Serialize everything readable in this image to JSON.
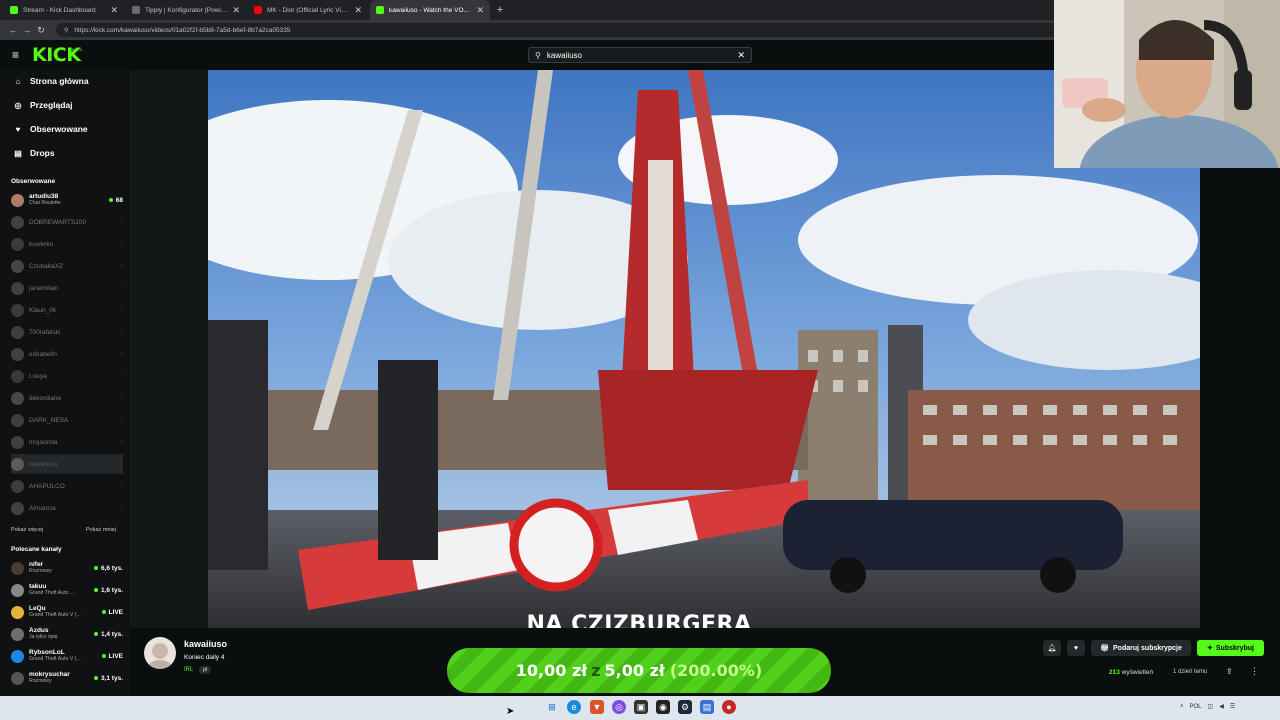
{
  "browser": {
    "tabs": [
      {
        "label": "Stream - Kick Dashboard",
        "color": "#53fc18",
        "active": false
      },
      {
        "label": "Tipply | Konfigurator (Powiadomi",
        "color": "#6b6b6b",
        "active": false
      },
      {
        "label": "MK - Dior (Official Lyric Video) ft.",
        "color": "#ff0000",
        "active": false
      },
      {
        "label": "kawaiiuso - Watch the VOD o",
        "color": "#53fc18",
        "active": true
      }
    ],
    "url": "https://kick.com/kawaiiuso/videos/01a02f2f-b5b8-7a5d-b6ef-8b7a2ca05335"
  },
  "header": {
    "logo": "KICK",
    "logo_badge": "BETA",
    "search_value": "kawaiiuso"
  },
  "sidebar": {
    "nav": [
      {
        "label": "Strona główna",
        "icon": "home-icon"
      },
      {
        "label": "Przeglądaj",
        "icon": "compass-icon"
      },
      {
        "label": "Obserwowane",
        "icon": "heart-icon"
      },
      {
        "label": "Drops",
        "icon": "drops-icon"
      }
    ],
    "followed_title": "Obserwowane",
    "followed": [
      {
        "name": "artudiu38",
        "sub": "Chat Roulette",
        "count": "68",
        "live": true
      },
      {
        "name": "DOBREWARTS100",
        "live": false
      },
      {
        "name": "kuwerku",
        "live": false
      },
      {
        "name": "CzubakaXZ",
        "live": false
      },
      {
        "name": "janemilian",
        "live": false
      },
      {
        "name": "Klaun_0k",
        "live": false
      },
      {
        "name": "700rafalski",
        "live": false
      },
      {
        "name": "erikabelin",
        "live": false
      },
      {
        "name": "Loeya",
        "live": false
      },
      {
        "name": "dekordiane",
        "live": false
      },
      {
        "name": "DARK_NESA",
        "live": false
      },
      {
        "name": "mojoonda",
        "live": false
      },
      {
        "name": "kawaiiuso",
        "live": false,
        "selected": true
      },
      {
        "name": "AHAPULCO",
        "live": false
      },
      {
        "name": "Aimancia",
        "live": false
      }
    ],
    "show_more": "Pokaż więcej",
    "show_less": "Pokaż mniej",
    "recommended_title": "Polecane kanały",
    "recommended": [
      {
        "name": "nifer",
        "sub": "Rozmowy",
        "count": "6,6 tys."
      },
      {
        "name": "takuu",
        "sub": "Grand Theft Auto ...",
        "count": "1,6 tys."
      },
      {
        "name": "LeQu",
        "sub": "Grand Theft Auto V (...",
        "count": "LIVE"
      },
      {
        "name": "Azdus",
        "sub": "Ja tylko śpię",
        "count": "1,4 tys."
      },
      {
        "name": "RybsonLoL",
        "sub": "Grand Theft Auto V (...",
        "count": "LIVE"
      },
      {
        "name": "mokrysuchar",
        "sub": "Rozmowy",
        "count": "3,1 tys."
      }
    ]
  },
  "video": {
    "caption": "NA CZIZBURGERA"
  },
  "channel": {
    "name": "kawaiiuso",
    "title": "Koniec daily 4",
    "category": "IRL",
    "language": "pl"
  },
  "goal": {
    "current": "10,00 zł",
    "separator": "z",
    "target": "5,00 zł",
    "percent": "(200.00%)",
    "progress": 2.0
  },
  "actions": {
    "gift_label": "Podaruj subskrypcje",
    "subscribe_label": "Subskrybuj",
    "views_count": "213",
    "views_label": "wyświetleń",
    "time_ago": "1 dzień temu"
  },
  "taskbar": {
    "tray_lang": "POL"
  }
}
